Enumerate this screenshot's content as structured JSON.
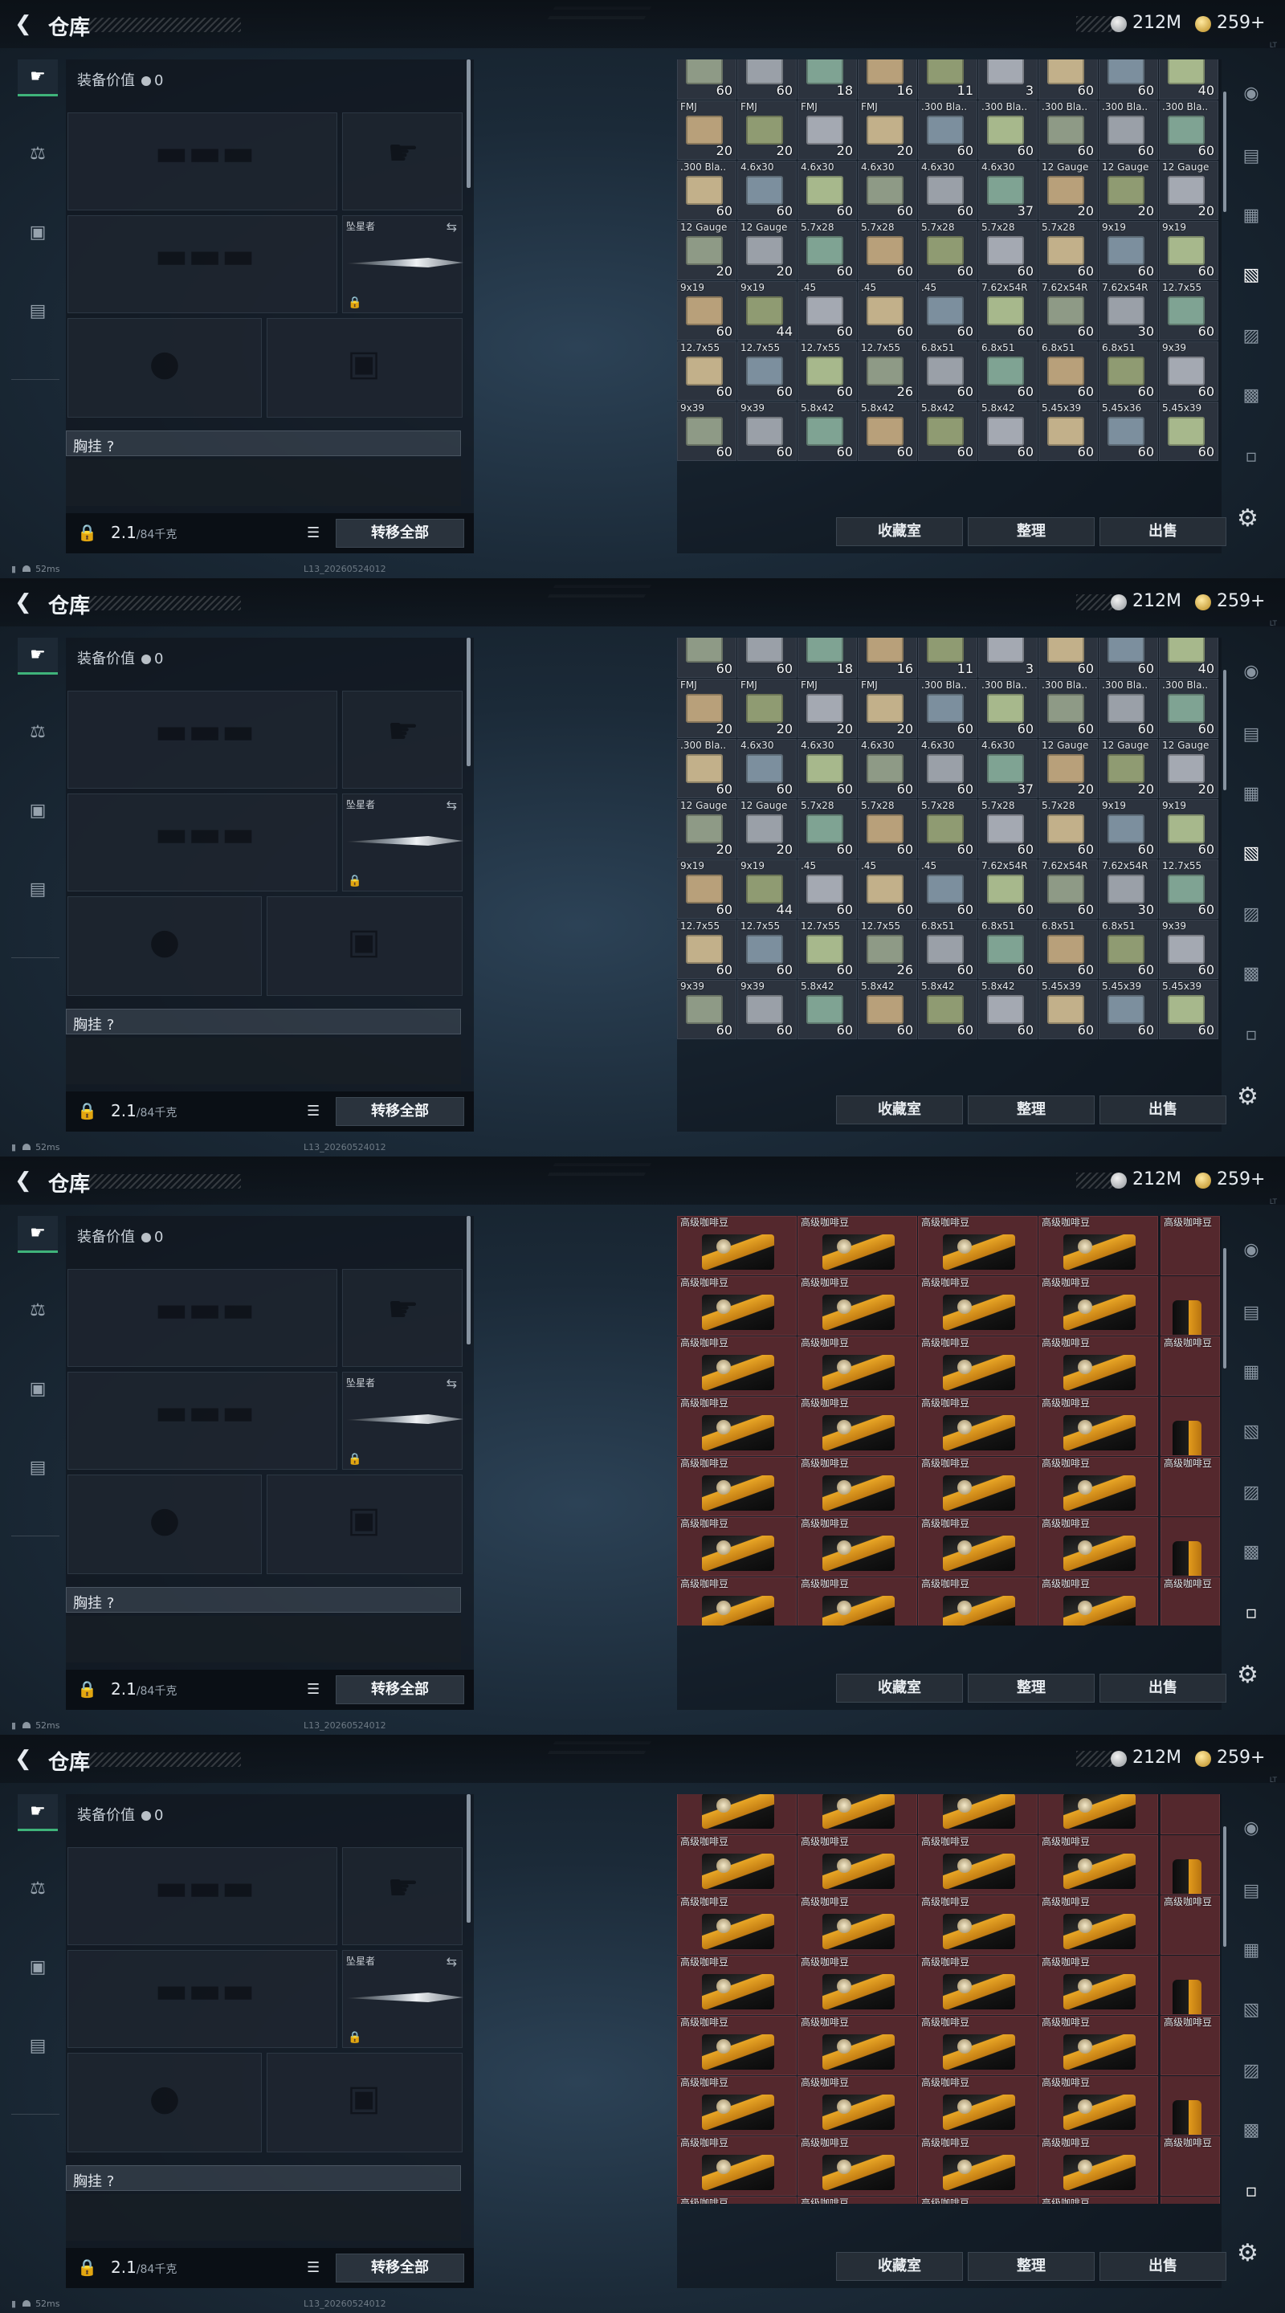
{
  "header": {
    "title": "仓库",
    "silver": "212M",
    "gold": "259+",
    "version_tag": "LT"
  },
  "left_rail": {
    "icons": [
      "weapon-icon",
      "armor-icon",
      "backpack-icon",
      "case-icon"
    ]
  },
  "equipment": {
    "value_label": "装备价值",
    "value": "0",
    "slot_label_melee": "坠星者",
    "vest_label": "胸挂 ?",
    "weight_value": "2.1",
    "weight_cap": "/84千克",
    "transfer_all": "转移全部"
  },
  "status": {
    "ping": "52ms",
    "build": "L13_20260524012"
  },
  "storage_buttons": {
    "collection": "收藏室",
    "sort": "整理",
    "sell": "出售"
  },
  "colors": {
    "accent": "#3fb37a",
    "coffee_bg": "#54282d",
    "ammo_bg": "#2c333e"
  },
  "panels": [
    {
      "rows": [
        [
          {
            "n": "",
            "c": "60"
          },
          {
            "n": "",
            "c": "60"
          },
          {
            "n": "",
            "c": "18"
          },
          {
            "n": "",
            "c": "16"
          },
          {
            "n": "",
            "c": "11"
          },
          {
            "n": "",
            "c": "3"
          },
          {
            "n": "",
            "c": "60"
          },
          {
            "n": "",
            "c": "60"
          },
          {
            "n": "",
            "c": "40"
          }
        ],
        [
          {
            "n": "FMJ",
            "c": "20"
          },
          {
            "n": "FMJ",
            "c": "20"
          },
          {
            "n": "FMJ",
            "c": "20"
          },
          {
            "n": "FMJ",
            "c": "20"
          },
          {
            "n": ".300 Bla..",
            "c": "60"
          },
          {
            "n": ".300 Bla..",
            "c": "60"
          },
          {
            "n": ".300 Bla..",
            "c": "60"
          },
          {
            "n": ".300 Bla..",
            "c": "60"
          },
          {
            "n": ".300 Bla..",
            "c": "60"
          }
        ],
        [
          {
            "n": ".300 Bla..",
            "c": "60"
          },
          {
            "n": "4.6x30",
            "c": "60"
          },
          {
            "n": "4.6x30",
            "c": "60"
          },
          {
            "n": "4.6x30",
            "c": "60"
          },
          {
            "n": "4.6x30",
            "c": "60"
          },
          {
            "n": "4.6x30",
            "c": "37"
          },
          {
            "n": "12 Gauge",
            "c": "20"
          },
          {
            "n": "12 Gauge",
            "c": "20"
          },
          {
            "n": "12 Gauge",
            "c": "20"
          }
        ],
        [
          {
            "n": "12 Gauge",
            "c": "20"
          },
          {
            "n": "12 Gauge",
            "c": "20"
          },
          {
            "n": "5.7x28",
            "c": "60"
          },
          {
            "n": "5.7x28",
            "c": "60"
          },
          {
            "n": "5.7x28",
            "c": "60"
          },
          {
            "n": "5.7x28",
            "c": "60"
          },
          {
            "n": "5.7x28",
            "c": "60"
          },
          {
            "n": "9x19",
            "c": "60"
          },
          {
            "n": "9x19",
            "c": "60"
          }
        ],
        [
          {
            "n": "9x19",
            "c": "60"
          },
          {
            "n": "9x19",
            "c": "44"
          },
          {
            "n": ".45",
            "c": "60"
          },
          {
            "n": ".45",
            "c": "60"
          },
          {
            "n": ".45",
            "c": "60"
          },
          {
            "n": "7.62x54R",
            "c": "60"
          },
          {
            "n": "7.62x54R",
            "c": "60"
          },
          {
            "n": "7.62x54R",
            "c": "30"
          },
          {
            "n": "12.7x55",
            "c": "60"
          }
        ],
        [
          {
            "n": "12.7x55",
            "c": "60"
          },
          {
            "n": "12.7x55",
            "c": "60"
          },
          {
            "n": "12.7x55",
            "c": "60"
          },
          {
            "n": "12.7x55",
            "c": "26"
          },
          {
            "n": "6.8x51",
            "c": "60"
          },
          {
            "n": "6.8x51",
            "c": "60"
          },
          {
            "n": "6.8x51",
            "c": "60"
          },
          {
            "n": "6.8x51",
            "c": "60"
          },
          {
            "n": "9x39",
            "c": "60"
          }
        ],
        [
          {
            "n": "9x39",
            "c": "60"
          },
          {
            "n": "9x39",
            "c": "60"
          },
          {
            "n": "5.8x42",
            "c": "60"
          },
          {
            "n": "5.8x42",
            "c": "60"
          },
          {
            "n": "5.8x42",
            "c": "60"
          },
          {
            "n": "5.8x42",
            "c": "60"
          },
          {
            "n": "5.45x39",
            "c": "60"
          },
          {
            "n": "5.45x36",
            "c": "60"
          },
          {
            "n": "5.45x39",
            "c": "60"
          }
        ]
      ]
    },
    {
      "rows": [
        [
          {
            "n": "",
            "c": "60"
          },
          {
            "n": "",
            "c": "60"
          },
          {
            "n": "",
            "c": "18"
          },
          {
            "n": "",
            "c": "16"
          },
          {
            "n": "",
            "c": "11"
          },
          {
            "n": "",
            "c": "3"
          },
          {
            "n": "",
            "c": "60"
          },
          {
            "n": "",
            "c": "60"
          },
          {
            "n": "",
            "c": "40"
          }
        ],
        [
          {
            "n": "FMJ",
            "c": "20"
          },
          {
            "n": "FMJ",
            "c": "20"
          },
          {
            "n": "FMJ",
            "c": "20"
          },
          {
            "n": "FMJ",
            "c": "20"
          },
          {
            "n": ".300 Bla..",
            "c": "60"
          },
          {
            "n": ".300 Bla..",
            "c": "60"
          },
          {
            "n": ".300 Bla..",
            "c": "60"
          },
          {
            "n": ".300 Bla..",
            "c": "60"
          },
          {
            "n": ".300 Bla..",
            "c": "60"
          }
        ],
        [
          {
            "n": ".300 Bla..",
            "c": "60"
          },
          {
            "n": "4.6x30",
            "c": "60"
          },
          {
            "n": "4.6x30",
            "c": "60"
          },
          {
            "n": "4.6x30",
            "c": "60"
          },
          {
            "n": "4.6x30",
            "c": "60"
          },
          {
            "n": "4.6x30",
            "c": "37"
          },
          {
            "n": "12 Gauge",
            "c": "20"
          },
          {
            "n": "12 Gauge",
            "c": "20"
          },
          {
            "n": "12 Gauge",
            "c": "20"
          }
        ],
        [
          {
            "n": "12 Gauge",
            "c": "20"
          },
          {
            "n": "12 Gauge",
            "c": "20"
          },
          {
            "n": "5.7x28",
            "c": "60"
          },
          {
            "n": "5.7x28",
            "c": "60"
          },
          {
            "n": "5.7x28",
            "c": "60"
          },
          {
            "n": "5.7x28",
            "c": "60"
          },
          {
            "n": "5.7x28",
            "c": "60"
          },
          {
            "n": "9x19",
            "c": "60"
          },
          {
            "n": "9x19",
            "c": "60"
          }
        ],
        [
          {
            "n": "9x19",
            "c": "60"
          },
          {
            "n": "9x19",
            "c": "44"
          },
          {
            "n": ".45",
            "c": "60"
          },
          {
            "n": ".45",
            "c": "60"
          },
          {
            "n": ".45",
            "c": "60"
          },
          {
            "n": "7.62x54R",
            "c": "60"
          },
          {
            "n": "7.62x54R",
            "c": "60"
          },
          {
            "n": "7.62x54R",
            "c": "30"
          },
          {
            "n": "12.7x55",
            "c": "60"
          }
        ],
        [
          {
            "n": "12.7x55",
            "c": "60"
          },
          {
            "n": "12.7x55",
            "c": "60"
          },
          {
            "n": "12.7x55",
            "c": "60"
          },
          {
            "n": "12.7x55",
            "c": "26"
          },
          {
            "n": "6.8x51",
            "c": "60"
          },
          {
            "n": "6.8x51",
            "c": "60"
          },
          {
            "n": "6.8x51",
            "c": "60"
          },
          {
            "n": "6.8x51",
            "c": "60"
          },
          {
            "n": "9x39",
            "c": "60"
          }
        ],
        [
          {
            "n": "9x39",
            "c": "60"
          },
          {
            "n": "9x39",
            "c": "60"
          },
          {
            "n": "5.8x42",
            "c": "60"
          },
          {
            "n": "5.8x42",
            "c": "60"
          },
          {
            "n": "5.8x42",
            "c": "60"
          },
          {
            "n": "5.8x42",
            "c": "60"
          },
          {
            "n": "5.45x39",
            "c": "60"
          },
          {
            "n": "5.45x39",
            "c": "60"
          },
          {
            "n": "5.45x39",
            "c": "60"
          }
        ]
      ]
    },
    {
      "coffee": true,
      "offset": 0
    },
    {
      "coffee": true,
      "offset": -24
    }
  ],
  "coffee_label": "高级咖啡豆"
}
